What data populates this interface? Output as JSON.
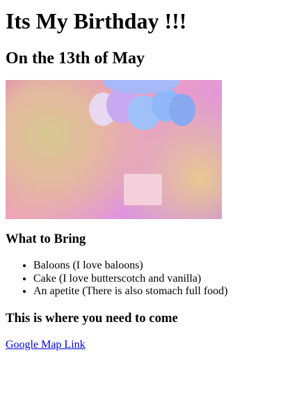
{
  "title": "Its My Birthday !!!",
  "subtitle": "On the 13th of May",
  "bring_heading": "What to Bring",
  "items": [
    "Baloons (I love baloons)",
    "Cake (I love butterscotch and vanilla)",
    "An apetite (There is also stomach full food)"
  ],
  "where_heading": "This is where you need to come",
  "map_link": "Google Map Link"
}
